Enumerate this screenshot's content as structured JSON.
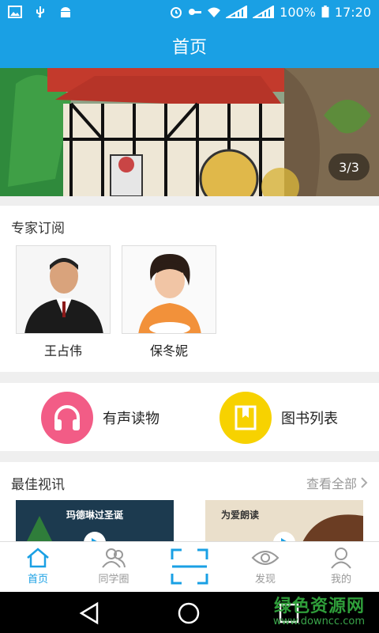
{
  "status_bar": {
    "battery": "100%",
    "time": "17:20",
    "left_icons": [
      "gallery-icon",
      "usb-icon",
      "android-icon"
    ],
    "right_icons": [
      "alarm-icon",
      "key-icon",
      "wifi-icon",
      "signal-icon",
      "signal-icon",
      "battery-icon"
    ]
  },
  "header": {
    "title": "首页"
  },
  "banner": {
    "pager": "3/3"
  },
  "experts": {
    "title": "专家订阅",
    "items": [
      {
        "name": "王占伟"
      },
      {
        "name": "保冬妮"
      }
    ]
  },
  "categories": [
    {
      "label": "有声读物",
      "icon": "headphones-icon",
      "color": "#f25c86"
    },
    {
      "label": "图书列表",
      "icon": "book-icon",
      "color": "#f7d200"
    }
  ],
  "news": {
    "title": "最佳视讯",
    "more": "查看全部",
    "items": [
      {
        "title": "玛德琳过圣诞"
      },
      {
        "title": "为爱朗读"
      }
    ]
  },
  "bottom_nav": [
    {
      "label": "首页",
      "icon": "home-icon",
      "active": true
    },
    {
      "label": "同学圈",
      "icon": "people-icon",
      "active": false
    },
    {
      "label": "",
      "icon": "scan-icon",
      "active": false
    },
    {
      "label": "发现",
      "icon": "eye-icon",
      "active": false
    },
    {
      "label": "我的",
      "icon": "user-icon",
      "active": false
    }
  ],
  "watermark": {
    "line1": "绿色资源网",
    "line2": "www.downcc.com"
  },
  "colors": {
    "primary": "#1aa0e4",
    "inactive": "#999999"
  }
}
